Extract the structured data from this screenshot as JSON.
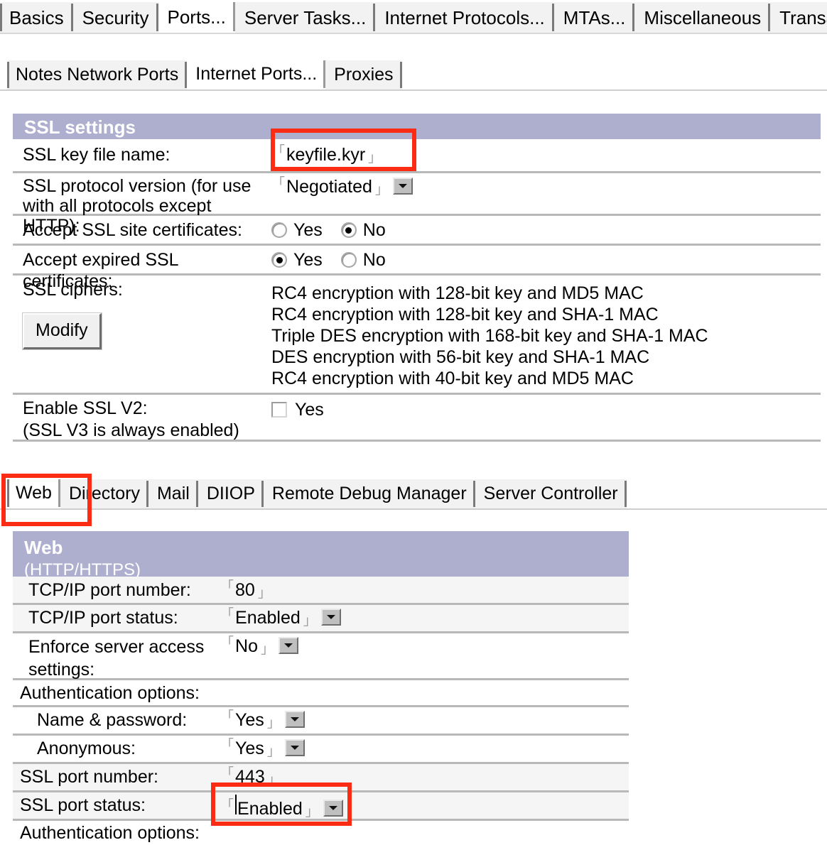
{
  "primary_tabs": [
    {
      "label": "Basics",
      "active": false
    },
    {
      "label": "Security",
      "active": false
    },
    {
      "label": "Ports...",
      "active": true
    },
    {
      "label": "Server Tasks...",
      "active": false
    },
    {
      "label": "Internet Protocols...",
      "active": false
    },
    {
      "label": "MTAs...",
      "active": false
    },
    {
      "label": "Miscellaneous",
      "active": false
    },
    {
      "label": "Transaction",
      "active": false
    }
  ],
  "secondary_tabs": [
    {
      "label": "Notes Network Ports",
      "active": false
    },
    {
      "label": "Internet Ports...",
      "active": true
    },
    {
      "label": "Proxies",
      "active": false
    }
  ],
  "section_tabs": [
    {
      "label": "Web",
      "active": true
    },
    {
      "label": "Directory",
      "active": false
    },
    {
      "label": "Mail",
      "active": false
    },
    {
      "label": "DIIOP",
      "active": false
    },
    {
      "label": "Remote Debug Manager",
      "active": false
    },
    {
      "label": "Server Controller",
      "active": false
    }
  ],
  "ssl_settings": {
    "band_title": "SSL settings",
    "key_file": {
      "label": "SSL key file name:",
      "value": "keyfile.kyr"
    },
    "protocol_version": {
      "label_line1": "SSL protocol version (for use",
      "label_line2": "with all protocols except HTTP):",
      "value": "Negotiated"
    },
    "accept_site_certs": {
      "label": "Accept SSL site certificates:",
      "yes_label": "Yes",
      "no_label": "No",
      "selected": "No"
    },
    "accept_expired_certs": {
      "label": "Accept expired SSL certificates:",
      "yes_label": "Yes",
      "no_label": "No",
      "selected": "Yes"
    },
    "ciphers": {
      "label": "SSL ciphers:",
      "modify_button": "Modify",
      "items": [
        "RC4 encryption with 128-bit key and MD5 MAC",
        "RC4 encryption with 128-bit key and SHA-1 MAC",
        "Triple DES encryption with 168-bit key and SHA-1 MAC",
        "DES encryption with 56-bit key and SHA-1 MAC",
        "RC4 encryption with 40-bit key and MD5 MAC"
      ]
    },
    "enable_ssl_v2": {
      "label_line1": "Enable SSL V2:",
      "label_line2": "(SSL V3 is always enabled)",
      "checkbox_label": "Yes",
      "checked": false
    }
  },
  "web_section": {
    "band_title": "Web",
    "band_sub": "(HTTP/HTTPS)",
    "tcpip_port_number": {
      "label": "TCP/IP port number:",
      "value": "80"
    },
    "tcpip_port_status": {
      "label": "TCP/IP port status:",
      "value": "Enabled"
    },
    "enforce_access": {
      "label_line1": "Enforce server access",
      "label_line2": "settings:",
      "value": "No"
    },
    "auth_options_header": "Authentication options:",
    "name_password": {
      "label": "Name & password:",
      "value": "Yes"
    },
    "anonymous": {
      "label": "Anonymous:",
      "value": "Yes"
    },
    "ssl_port_number": {
      "label": "SSL port number:",
      "value": "443"
    },
    "ssl_port_status": {
      "label": "SSL port status:",
      "value": "Enabled"
    },
    "auth_options_header2": "Authentication options:"
  },
  "colors": {
    "band": "#aeaecf",
    "annotation": "#fb2b14",
    "row_shade": "#f5f5f5",
    "separator": "#b8b8b8"
  }
}
